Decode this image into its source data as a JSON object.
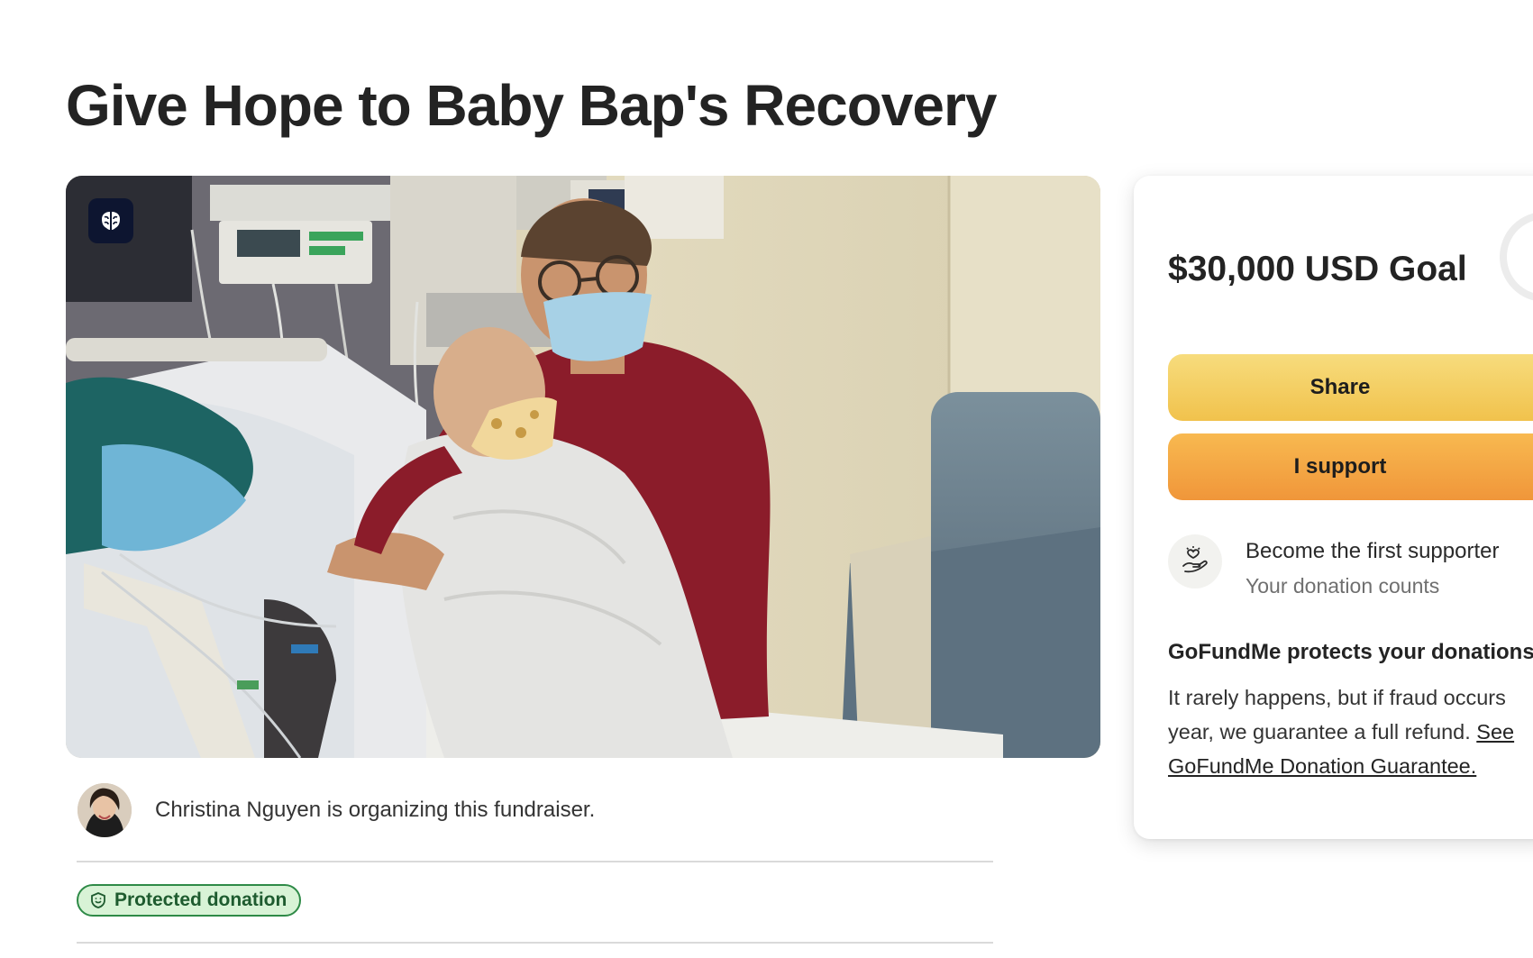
{
  "title": "Give Hope to Baby Bap's Recovery",
  "hero": {
    "badge_icon": "brain-icon"
  },
  "organizer": {
    "text": "Christina Nguyen is organizing this fundraiser."
  },
  "protected_badge": {
    "label": "Protected donation",
    "icon": "shield-icon"
  },
  "sidebar": {
    "goal": "$30,000 USD Goal",
    "share_label": "Share",
    "support_label": "I support",
    "first_supporter": {
      "icon": "hand-heart-icon",
      "title": "Become the first supporter",
      "subtitle": "Your donation counts"
    },
    "protection": {
      "heading": "GoFundMe protects your donations",
      "line1": "It rarely happens, but if fraud occurs",
      "line2_prefix": "year, we guarantee a full refund. ",
      "link_part1": "See",
      "link_part2": "GoFundMe Donation Guarantee."
    }
  },
  "colors": {
    "share_button": "#f3cc5a",
    "support_button": "#f4a845",
    "protected_badge_bg": "#d8f3d6",
    "protected_badge_border": "#2e8a47",
    "title_text": "#232323"
  }
}
